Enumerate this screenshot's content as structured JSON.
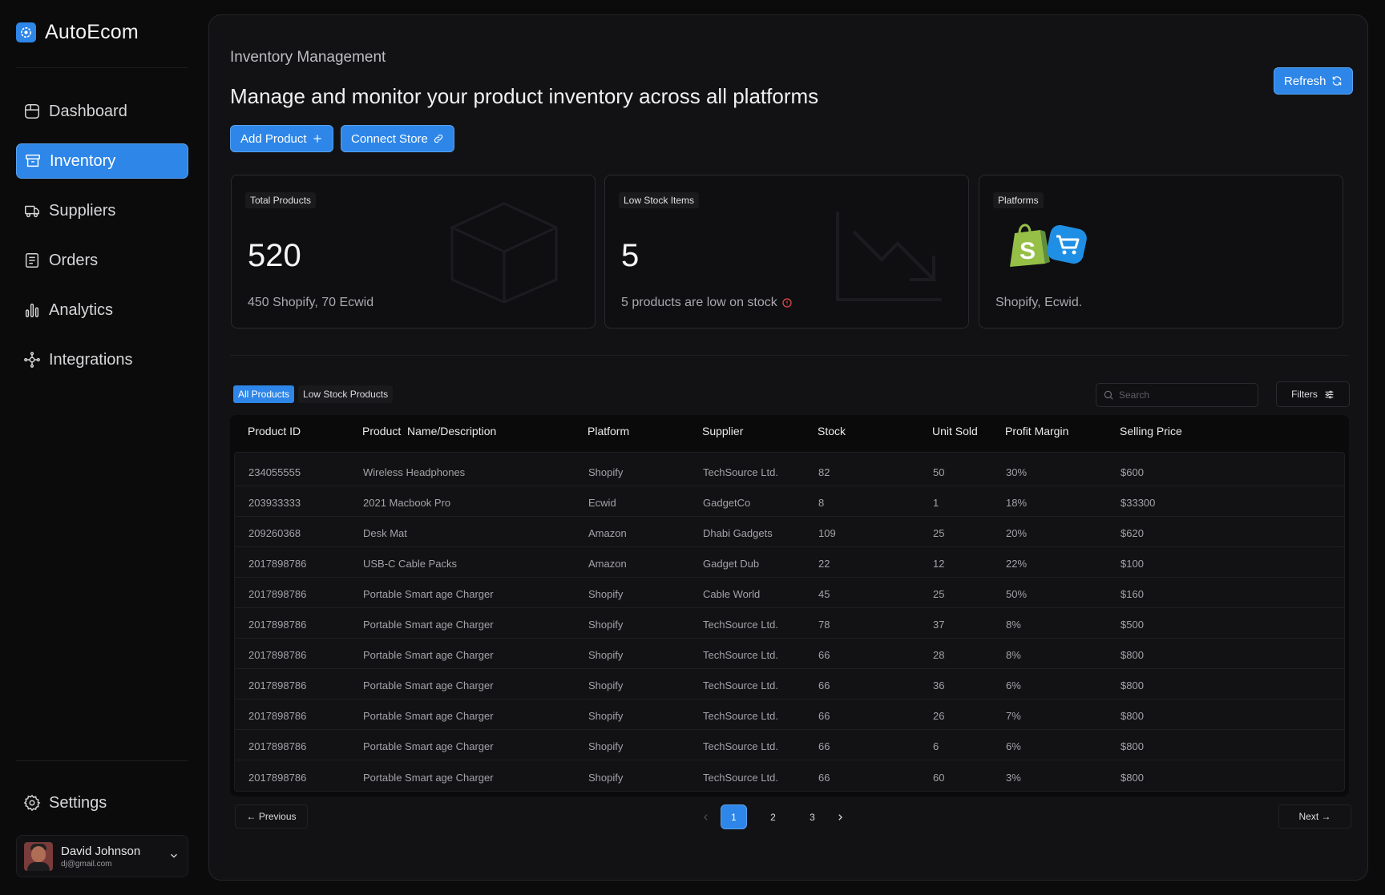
{
  "app": {
    "name": "AutoEcom"
  },
  "sidebar": {
    "items": [
      {
        "label": "Dashboard",
        "icon": "dashboard-icon"
      },
      {
        "label": "Inventory",
        "icon": "inventory-icon",
        "active": true
      },
      {
        "label": "Suppliers",
        "icon": "suppliers-icon"
      },
      {
        "label": "Orders",
        "icon": "orders-icon"
      },
      {
        "label": "Analytics",
        "icon": "analytics-icon"
      },
      {
        "label": "Integrations",
        "icon": "integrations-icon"
      }
    ],
    "settings_label": "Settings",
    "user": {
      "name": "David Johnson",
      "email": "dj@gmail.com"
    }
  },
  "header": {
    "title": "Inventory Management",
    "subtitle": "Manage and monitor your product inventory across all platforms",
    "refresh_label": "Refresh",
    "add_product_label": "Add Product",
    "connect_store_label": "Connect Store"
  },
  "cards": {
    "total_products": {
      "tag": "Total Products",
      "value": "520",
      "desc": "450 Shopify, 70 Ecwid"
    },
    "low_stock": {
      "tag": "Low Stock Items",
      "value": "5",
      "desc": "5 products are low on stock"
    },
    "platforms": {
      "tag": "Platforms",
      "desc": "Shopify, Ecwid."
    }
  },
  "tabs": {
    "all": "All Products",
    "low": "Low Stock Products"
  },
  "search": {
    "placeholder": "Search"
  },
  "filters_label": "Filters",
  "table": {
    "columns": [
      "Product ID",
      "Product  Name/Description",
      "Platform",
      "Supplier",
      "Stock",
      "Unit Sold",
      "Profit Margin",
      "Selling Price"
    ],
    "rows": [
      [
        "234055555",
        "Wireless Headphones",
        "Shopify",
        "TechSource Ltd.",
        "82",
        "50",
        "30%",
        "$600"
      ],
      [
        "203933333",
        "2021 Macbook Pro",
        "Ecwid",
        "GadgetCo",
        "8",
        "1",
        "18%",
        "$33300"
      ],
      [
        "209260368",
        "Desk Mat",
        "Amazon",
        "Dhabi Gadgets",
        "109",
        "25",
        "20%",
        "$620"
      ],
      [
        "2017898786",
        "USB-C Cable Packs",
        "Amazon",
        "Gadget Dub",
        "22",
        "12",
        "22%",
        "$100"
      ],
      [
        "2017898786",
        "Portable Smart age Charger",
        "Shopify",
        "Cable World",
        "45",
        "25",
        "50%",
        "$160"
      ],
      [
        "2017898786",
        "Portable Smart age Charger",
        "Shopify",
        "TechSource Ltd.",
        "78",
        "37",
        "8%",
        "$500"
      ],
      [
        "2017898786",
        "Portable Smart age Charger",
        "Shopify",
        "TechSource Ltd.",
        "66",
        "28",
        "8%",
        "$800"
      ],
      [
        "2017898786",
        "Portable Smart age Charger",
        "Shopify",
        "TechSource Ltd.",
        "66",
        "36",
        "6%",
        "$800"
      ],
      [
        "2017898786",
        "Portable Smart age Charger",
        "Shopify",
        "TechSource Ltd.",
        "66",
        "26",
        "7%",
        "$800"
      ],
      [
        "2017898786",
        "Portable Smart age Charger",
        "Shopify",
        "TechSource Ltd.",
        "66",
        "6",
        "6%",
        "$800"
      ],
      [
        "2017898786",
        "Portable Smart age Charger",
        "Shopify",
        "TechSource Ltd.",
        "66",
        "60",
        "3%",
        "$800"
      ]
    ]
  },
  "pagination": {
    "previous_label": "← Previous",
    "next_label": "Next →",
    "pages": [
      "1",
      "2",
      "3"
    ],
    "current": "1"
  },
  "colors": {
    "accent": "#2d86e8",
    "background": "#0b0b0c",
    "panel": "#121214",
    "warning": "#e5484d",
    "shopify": "#95bf47",
    "ecwid": "#1f8fe5"
  }
}
